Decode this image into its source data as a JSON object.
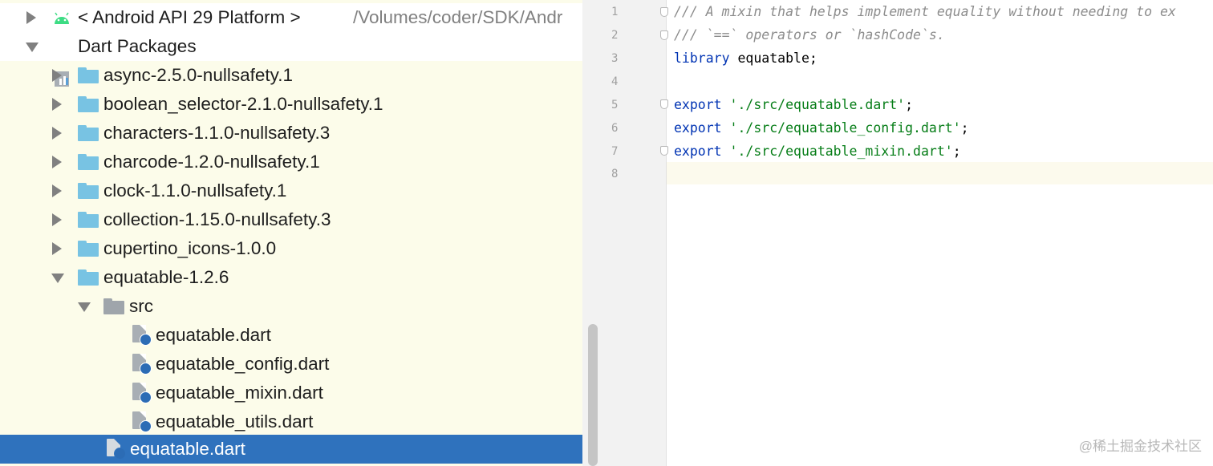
{
  "tree": {
    "android_platform": {
      "label": "< Android API 29 Platform >",
      "path": "/Volumes/coder/SDK/Andr"
    },
    "dart_packages": "Dart Packages",
    "packages": [
      "async-2.5.0-nullsafety.1",
      "boolean_selector-2.1.0-nullsafety.1",
      "characters-1.1.0-nullsafety.3",
      "charcode-1.2.0-nullsafety.1",
      "clock-1.1.0-nullsafety.1",
      "collection-1.15.0-nullsafety.3",
      "cupertino_icons-1.0.0"
    ],
    "expanded_package": "equatable-1.2.6",
    "src_folder": "src",
    "src_files": [
      "equatable.dart",
      "equatable_config.dart",
      "equatable_mixin.dart",
      "equatable_utils.dart"
    ],
    "selected_file": "equatable.dart"
  },
  "editor": {
    "line_numbers": [
      "1",
      "2",
      "3",
      "4",
      "5",
      "6",
      "7",
      "8"
    ],
    "lines": [
      {
        "comment": "/// A mixin that helps implement equality without needing to ex"
      },
      {
        "comment": "/// `==` operators or `hashCode`s."
      },
      {
        "keyword": "library",
        "rest": " equatable;"
      },
      {},
      {
        "keyword": "export",
        "string": "'./src/equatable.dart'",
        "rest": ";"
      },
      {
        "keyword": "export",
        "string": "'./src/equatable_config.dart'",
        "rest": ";"
      },
      {
        "keyword": "export",
        "string": "'./src/equatable_mixin.dart'",
        "rest": ";"
      },
      {}
    ]
  },
  "watermark": "@稀土掘金技术社区",
  "colors": {
    "tree_background": "#fcfcea",
    "selection": "#2f72bd",
    "folder": "#78c3e3",
    "keyword": "#0033b3",
    "string": "#067d17",
    "comment": "#8c8c8c"
  }
}
